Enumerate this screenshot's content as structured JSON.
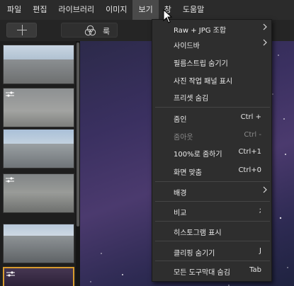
{
  "menubar": {
    "items": [
      {
        "label": "파일"
      },
      {
        "label": "편집"
      },
      {
        "label": "라이브러리"
      },
      {
        "label": "이미지"
      },
      {
        "label": "보기"
      },
      {
        "label": "창"
      },
      {
        "label": "도움말"
      }
    ],
    "active_index": 4
  },
  "toolbar": {
    "add_icon": "plus-icon",
    "look_icon": "looks-circles-icon",
    "look_label": "룩"
  },
  "filmstrip": {
    "selected_index": 5,
    "selected_color": "#d89b2e"
  },
  "view_menu": {
    "items": [
      {
        "label": "Raw + JPG 조합",
        "shortcut": "",
        "submenu": true,
        "disabled": false
      },
      {
        "label": "사이드바",
        "shortcut": "",
        "submenu": true,
        "disabled": false
      },
      {
        "label": "필름스트립 숨기기",
        "shortcut": "",
        "submenu": false,
        "disabled": false
      },
      {
        "label": "사진 작업 패널 표시",
        "shortcut": "",
        "submenu": false,
        "disabled": false
      },
      {
        "label": "프리셋 숨김",
        "shortcut": "",
        "submenu": false,
        "disabled": false
      },
      {
        "label": "줌인",
        "shortcut": "Ctrl +",
        "submenu": false,
        "disabled": false
      },
      {
        "label": "줌아웃",
        "shortcut": "Ctrl -",
        "submenu": false,
        "disabled": true
      },
      {
        "label": "100%로 줌하기",
        "shortcut": "Ctrl+1",
        "submenu": false,
        "disabled": false
      },
      {
        "label": "화면 맞춤",
        "shortcut": "Ctrl+0",
        "submenu": false,
        "disabled": false
      },
      {
        "label": "배경",
        "shortcut": "",
        "submenu": true,
        "disabled": false
      },
      {
        "label": "비교",
        "shortcut": ";",
        "submenu": false,
        "disabled": false
      },
      {
        "label": "히스토그램 표시",
        "shortcut": "",
        "submenu": false,
        "disabled": false
      },
      {
        "label": "클리핑 숨기기",
        "shortcut": "J",
        "submenu": false,
        "disabled": false
      },
      {
        "label": "모든 도구막대 숨김",
        "shortcut": "Tab",
        "submenu": false,
        "disabled": false
      }
    ]
  }
}
